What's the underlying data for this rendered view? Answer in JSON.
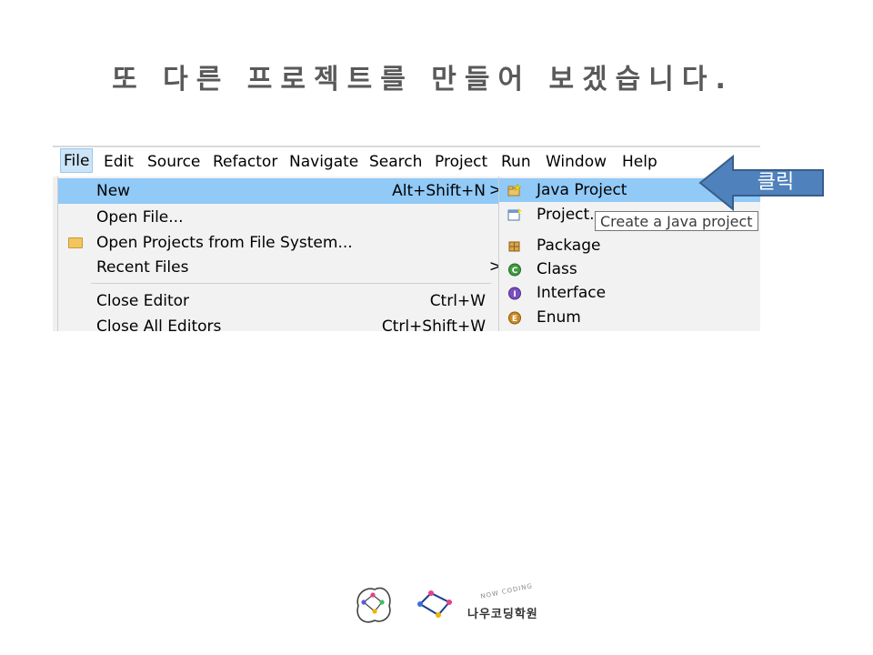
{
  "slide": {
    "title": "또 다른 프로젝트를 만들어 보겠습니다."
  },
  "menubar": {
    "items": [
      {
        "label": "File"
      },
      {
        "label": "Edit"
      },
      {
        "label": "Source"
      },
      {
        "label": "Refactor"
      },
      {
        "label": "Navigate"
      },
      {
        "label": "Search"
      },
      {
        "label": "Project"
      },
      {
        "label": "Run"
      },
      {
        "label": "Window"
      },
      {
        "label": "Help"
      }
    ]
  },
  "file_menu": {
    "items": [
      {
        "label": "New",
        "accel": "Alt+Shift+N",
        "arrow": ">"
      },
      {
        "label": "Open File..."
      },
      {
        "label": "Open Projects from File System..."
      },
      {
        "label": "Recent Files",
        "arrow": ">"
      },
      {
        "label": "Close Editor",
        "accel": "Ctrl+W"
      },
      {
        "label": "Close All Editors",
        "accel": "Ctrl+Shift+W"
      }
    ]
  },
  "new_submenu": {
    "items": [
      {
        "label": "Java Project",
        "icon": "java-project-icon"
      },
      {
        "label": "Project...",
        "icon": "project-icon"
      },
      {
        "label": "Package",
        "icon": "package-icon"
      },
      {
        "label": "Class",
        "icon": "class-icon"
      },
      {
        "label": "Interface",
        "icon": "interface-icon"
      },
      {
        "label": "Enum",
        "icon": "enum-icon"
      }
    ]
  },
  "tooltip": {
    "text": "Create a Java project"
  },
  "callout": {
    "text": "클릭",
    "color": "#4f81bd"
  },
  "logo": {
    "name": "나우코딩학원",
    "arc_text": "NOW CODING"
  },
  "colors": {
    "highlight": "#91c9f7",
    "title_text": "#595959"
  }
}
